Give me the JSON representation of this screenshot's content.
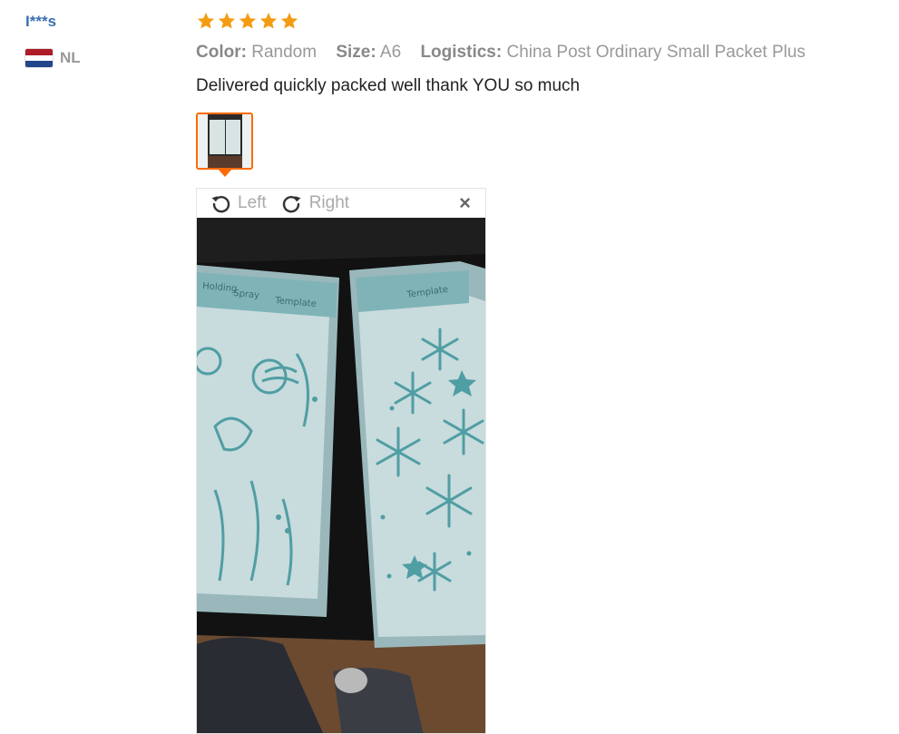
{
  "reviewer": {
    "name": "I***s",
    "country": "NL",
    "flag_colors": [
      "#ae1c28",
      "#ffffff",
      "#21468b"
    ]
  },
  "review": {
    "rating": 5,
    "star_color": "#f39c12",
    "attributes": [
      {
        "key": "Color:",
        "value": "Random"
      },
      {
        "key": "Size:",
        "value": "A6"
      },
      {
        "key": "Logistics:",
        "value": "China Post Ordinary Small Packet Plus"
      }
    ],
    "text": "Delivered quickly packed well thank YOU so much",
    "thumbnail_border_color": "#ff6a00"
  },
  "viewer": {
    "rotate_left_label": "Left",
    "rotate_right_label": "Right",
    "close_symbol": "×"
  }
}
